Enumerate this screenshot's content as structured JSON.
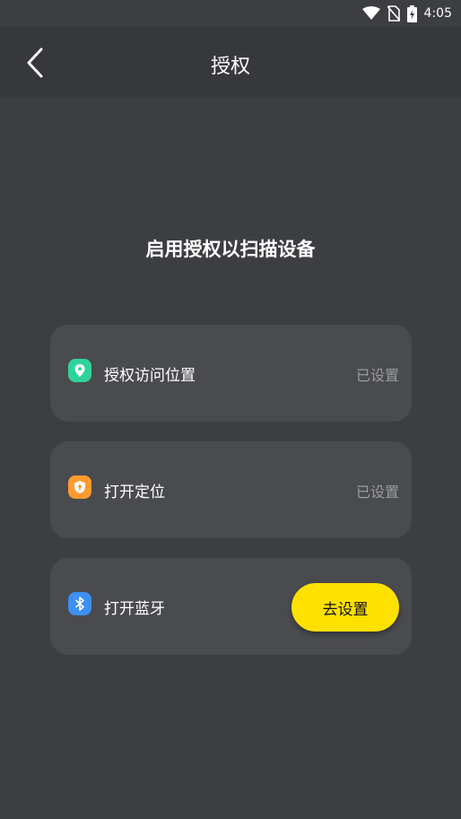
{
  "status_bar": {
    "time": "4:05"
  },
  "header": {
    "title": "授权"
  },
  "main": {
    "headline": "启用授权以扫描设备",
    "items": [
      {
        "label": "授权访问位置",
        "status": "已设置",
        "icon": "location-pin-icon",
        "color": "#2fd39a"
      },
      {
        "label": "打开定位",
        "status": "已设置",
        "icon": "shield-icon",
        "color": "#ff9a2e"
      },
      {
        "label": "打开蓝牙",
        "action": "去设置",
        "icon": "bluetooth-icon",
        "color": "#3d8ff0"
      }
    ]
  },
  "colors": {
    "background": "#3d3e42",
    "card": "#4a4b4f",
    "accent": "#ffe100"
  }
}
